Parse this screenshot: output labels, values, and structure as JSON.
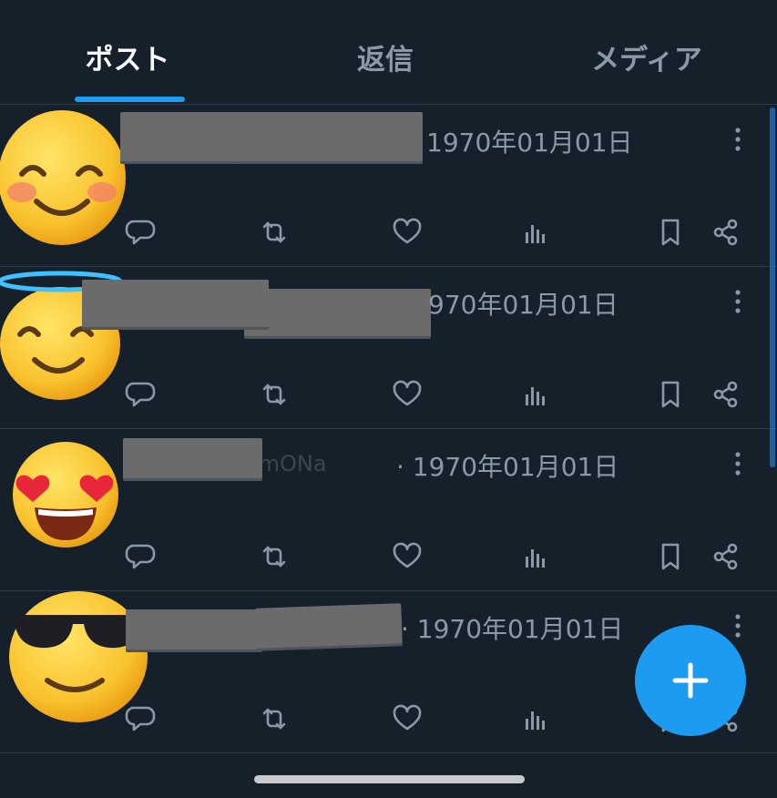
{
  "tabs": {
    "items": [
      {
        "label": "ポスト"
      },
      {
        "label": "返信"
      },
      {
        "label": "メディア"
      }
    ],
    "active_index": 0
  },
  "posts": [
    {
      "avatar": "smiling-face-icon",
      "date_text": "1970年01月01日",
      "handle_visible": ""
    },
    {
      "avatar": "halo-face-icon",
      "date_text": "970年01月01日",
      "handle_visible": ""
    },
    {
      "avatar": "heart-eyes-face-icon",
      "date_text": "· 1970年01月01日",
      "handle_visible": "ayomONa"
    },
    {
      "avatar": "sunglasses-face-icon",
      "date_text": "· 1970年01月01日",
      "handle_visible": ""
    }
  ],
  "actions": [
    "reply-icon",
    "repost-icon",
    "like-icon",
    "views-icon",
    "bookmark-icon",
    "share-icon"
  ],
  "fab": {
    "icon": "plus-icon"
  },
  "colors": {
    "background": "#15202b",
    "accent": "#1d9bf0",
    "text_primary": "#f7f9f9",
    "text_secondary": "#8b98a5"
  }
}
